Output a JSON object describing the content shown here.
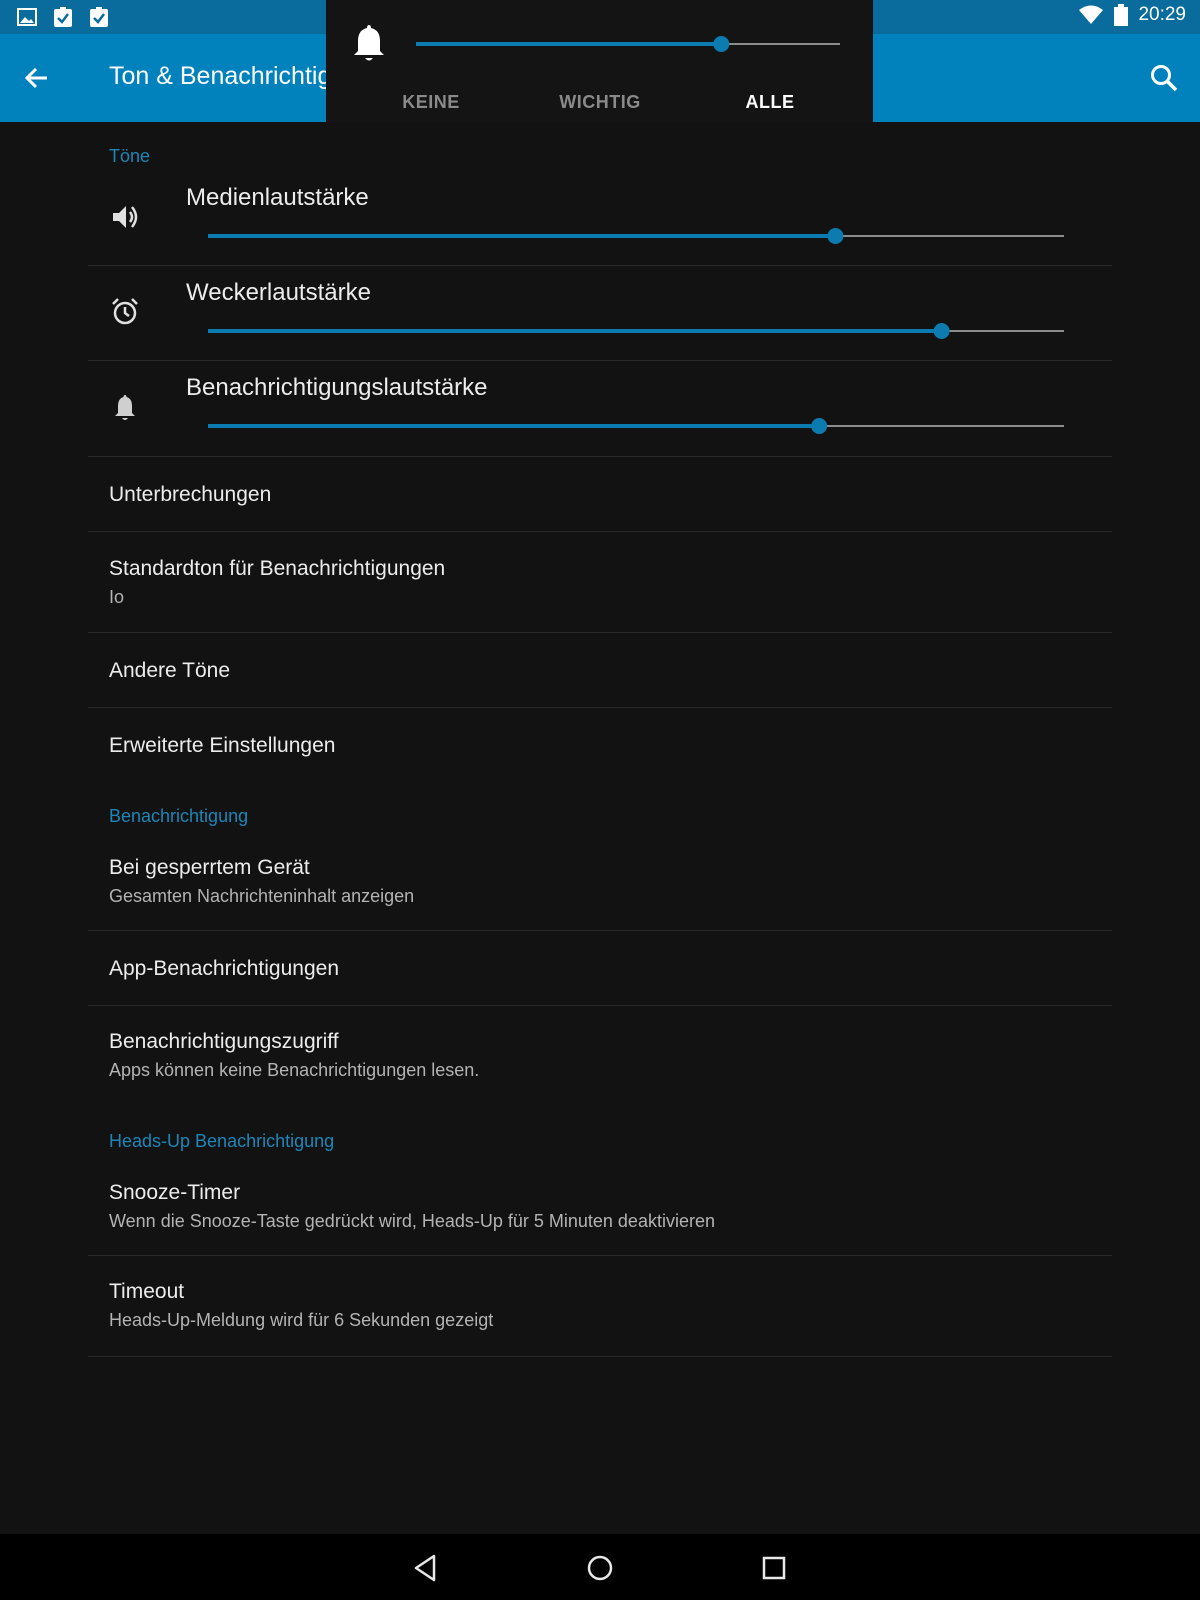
{
  "status_bar": {
    "time": "20:29",
    "left_icons": [
      "image-icon",
      "clipboard-check-icon",
      "clipboard-check-icon"
    ],
    "right_icons": [
      "wifi-icon",
      "battery-icon"
    ]
  },
  "app_bar": {
    "title": "Ton & Benachrichtigungen",
    "back_icon": "arrow-left-icon",
    "search_icon": "search-icon",
    "color": "#0282bd"
  },
  "volume_popup": {
    "icon": "bell-icon",
    "level": 0.72,
    "tabs": [
      {
        "label": "KEINE",
        "active": false
      },
      {
        "label": "WICHTIG",
        "active": false
      },
      {
        "label": "ALLE",
        "active": true
      }
    ]
  },
  "sections": {
    "tones": {
      "header": "Töne",
      "volumes": [
        {
          "label": "Medienlautstärke",
          "icon": "speaker-icon",
          "level": 0.733
        },
        {
          "label": "Weckerlautstärke",
          "icon": "alarm-clock-icon",
          "level": 0.857
        },
        {
          "label": "Benachrichtigungslautstärke",
          "icon": "bell-icon",
          "level": 0.714
        }
      ],
      "items": [
        {
          "title": "Unterbrechungen",
          "summary": ""
        },
        {
          "title": "Standardton für Benachrichtigungen",
          "summary": "Io"
        },
        {
          "title": "Andere Töne",
          "summary": ""
        },
        {
          "title": "Erweiterte Einstellungen",
          "summary": ""
        }
      ]
    },
    "notification": {
      "header": "Benachrichtigung",
      "items": [
        {
          "title": "Bei gesperrtem Gerät",
          "summary": "Gesamten Nachrichteninhalt anzeigen"
        },
        {
          "title": "App-Benachrichtigungen",
          "summary": ""
        },
        {
          "title": "Benachrichtigungszugriff",
          "summary": "Apps können keine Benachrichtigungen lesen."
        }
      ]
    },
    "heads_up": {
      "header": "Heads-Up Benachrichtigung",
      "items": [
        {
          "title": "Snooze-Timer",
          "summary": "Wenn die Snooze-Taste gedrückt wird, Heads-Up für 5 Minuten deaktivieren"
        },
        {
          "title": "Timeout",
          "summary": "Heads-Up-Meldung wird für 6 Sekunden gezeigt"
        }
      ]
    }
  },
  "nav_bar": {
    "buttons": [
      "back-triangle-icon",
      "home-circle-icon",
      "recents-square-icon"
    ]
  },
  "colors": {
    "accent": "#0b7bb0",
    "section_header": "#1d86b8",
    "background": "#121212",
    "status_bar": "#0a6c9c"
  }
}
